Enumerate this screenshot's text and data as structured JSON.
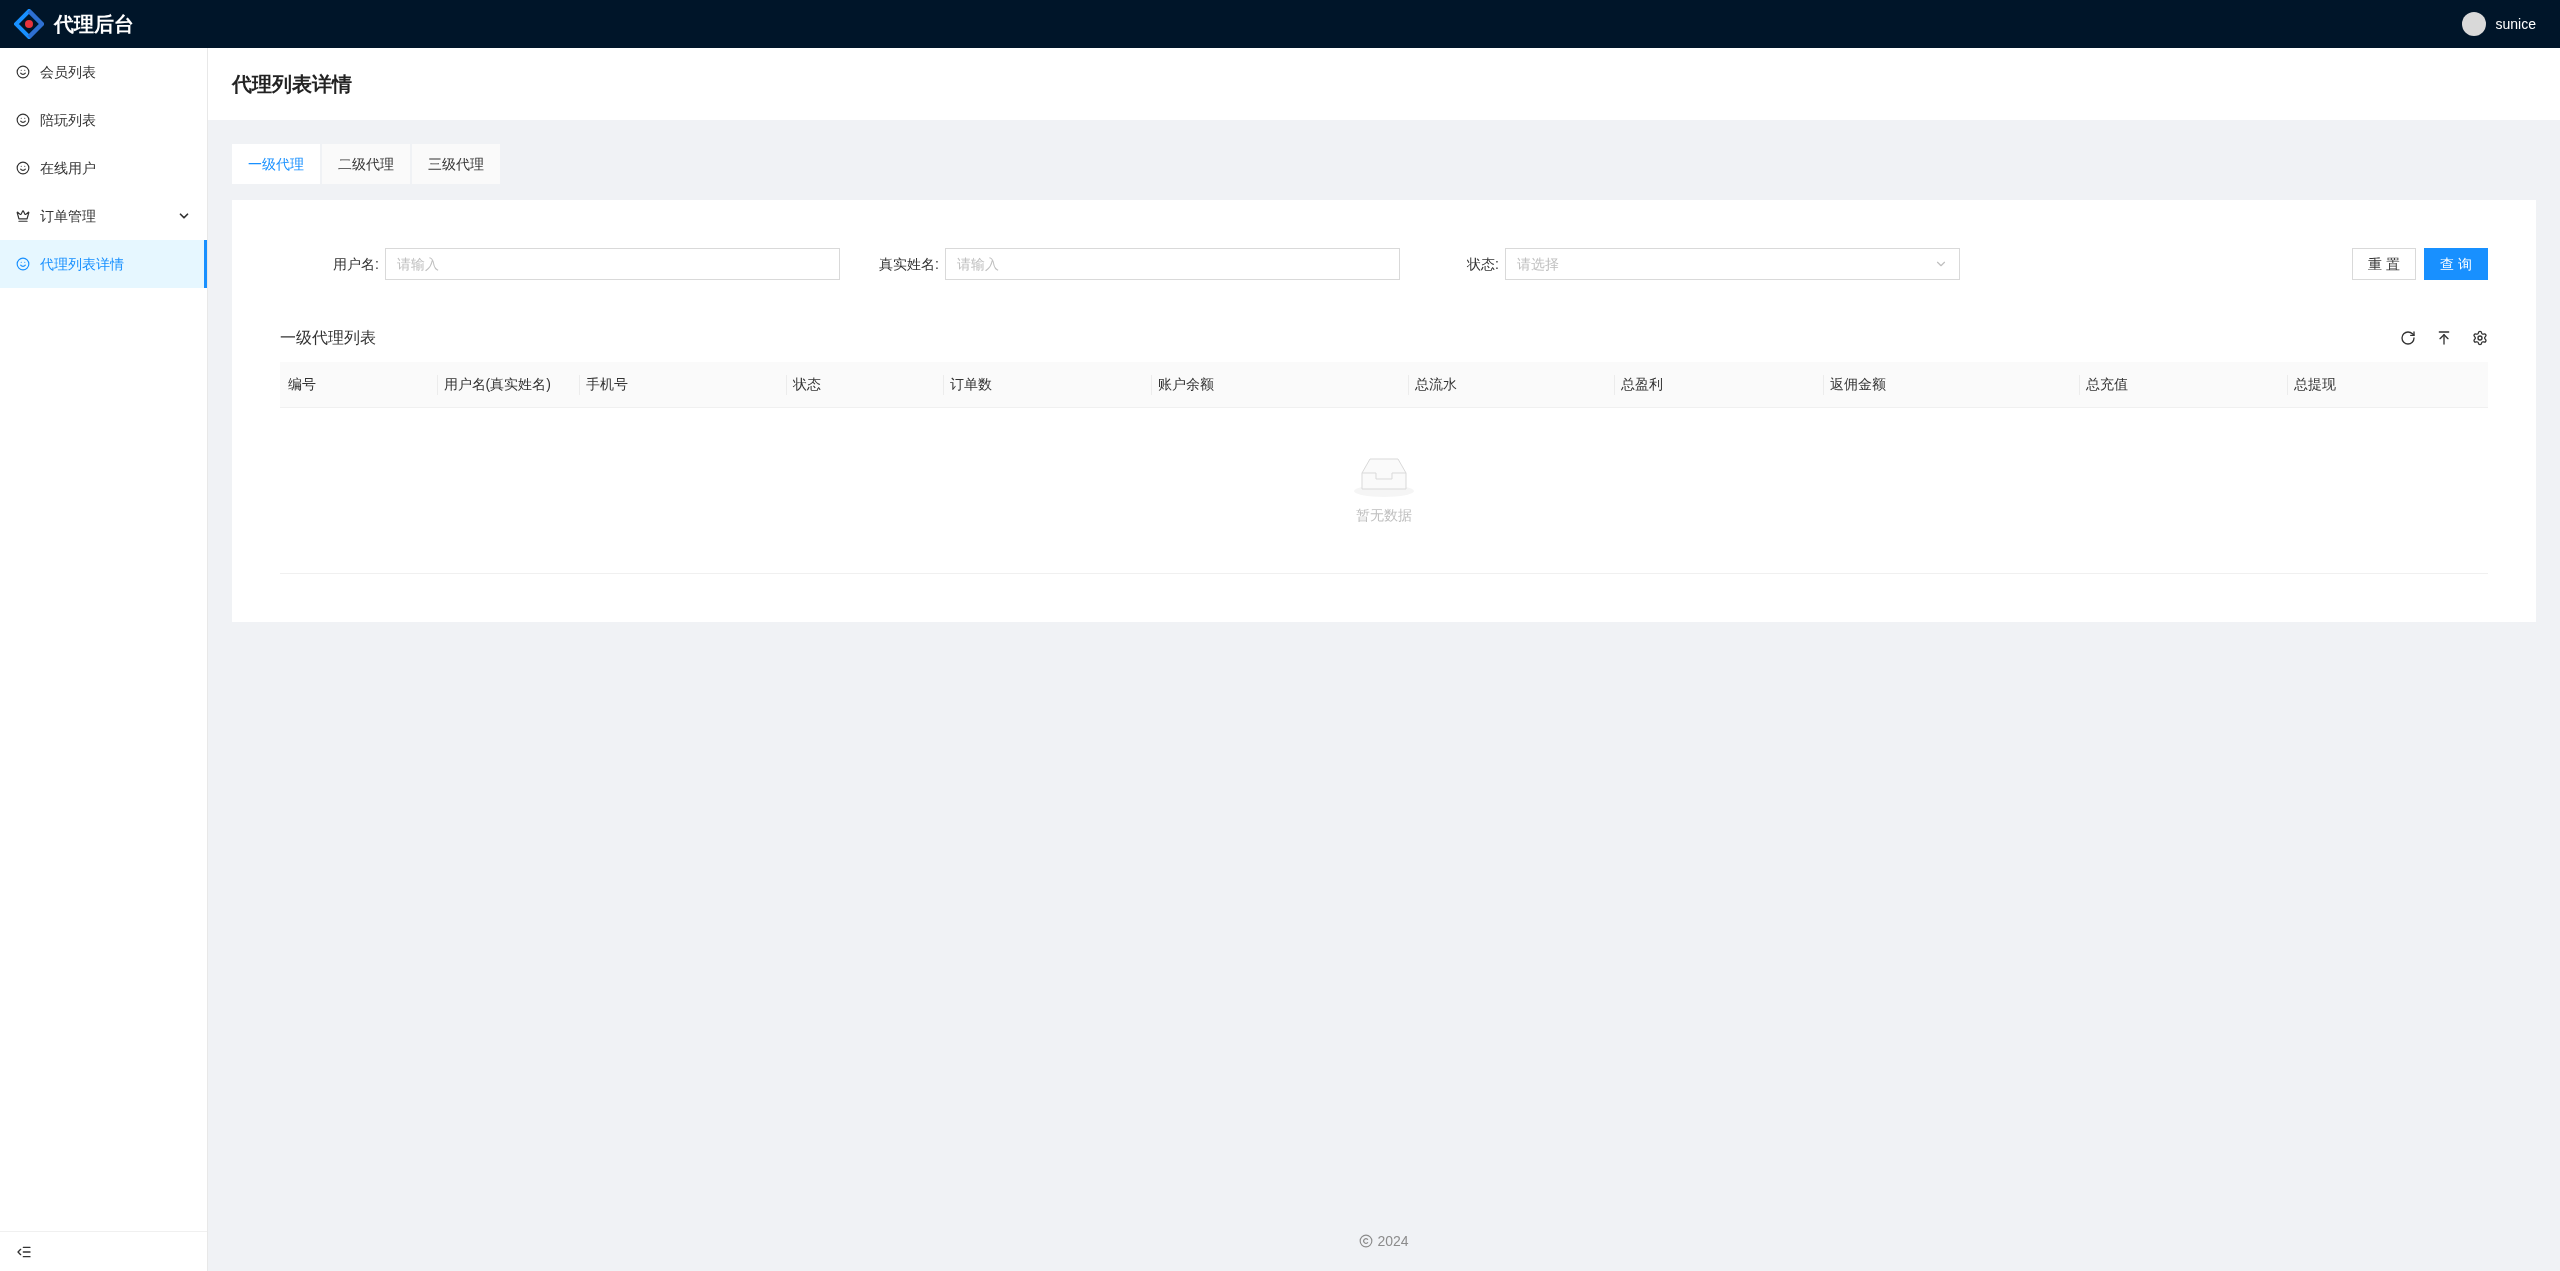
{
  "header": {
    "app_name": "代理后台",
    "user": "sunice"
  },
  "sidebar": {
    "items": [
      {
        "label": "会员列表",
        "kind": "smile",
        "selected": false
      },
      {
        "label": "陪玩列表",
        "kind": "smile",
        "selected": false
      },
      {
        "label": "在线用户",
        "kind": "smile",
        "selected": false
      },
      {
        "label": "订单管理",
        "kind": "crown",
        "selected": false,
        "expanded": false
      },
      {
        "label": "代理列表详情",
        "kind": "smile",
        "selected": true
      }
    ]
  },
  "page": {
    "title": "代理列表详情"
  },
  "tabs": [
    {
      "label": "一级代理",
      "selected": true
    },
    {
      "label": "二级代理",
      "selected": false
    },
    {
      "label": "三级代理",
      "selected": false
    }
  ],
  "filters": [
    {
      "label": "用户名:",
      "kind": "input",
      "placeholder": "请输入"
    },
    {
      "label": "真实姓名:",
      "kind": "input",
      "placeholder": "请输入"
    },
    {
      "label": "状态:",
      "kind": "select",
      "placeholder": "请选择"
    }
  ],
  "buttons": [
    {
      "label": "重 置",
      "kind": "default"
    },
    {
      "label": "查 询",
      "kind": "primary"
    }
  ],
  "table": {
    "title": "一级代理列表",
    "columns": [
      "编号",
      "用户名(真实姓名)",
      "手机号",
      "状态",
      "订单数",
      "账户余额",
      "总流水",
      "总盈利",
      "返佣金额",
      "总充值",
      "总提现"
    ],
    "empty_text": "暂无数据"
  },
  "footer": {
    "copyright": "2024"
  }
}
